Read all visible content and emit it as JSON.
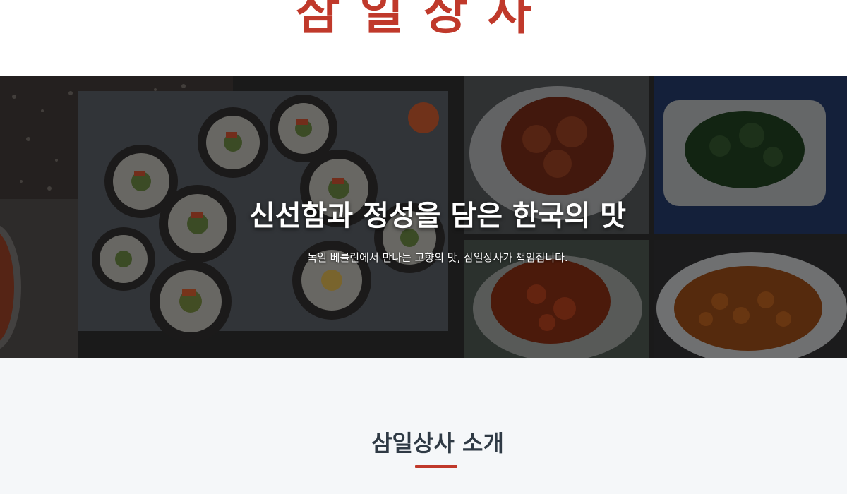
{
  "brand": {
    "name": "삼일상사"
  },
  "hero": {
    "title": "신선함과 정성을 담은 한국의 맛",
    "subtitle": "독일 베를린에서 만나는 고향의 맛, 삼일상사가 책임집니다."
  },
  "intro": {
    "title": "삼일상사 소개"
  },
  "colors": {
    "accent": "#c0392b",
    "heading": "#2f3a45",
    "section_bg": "#f5f7f9"
  }
}
